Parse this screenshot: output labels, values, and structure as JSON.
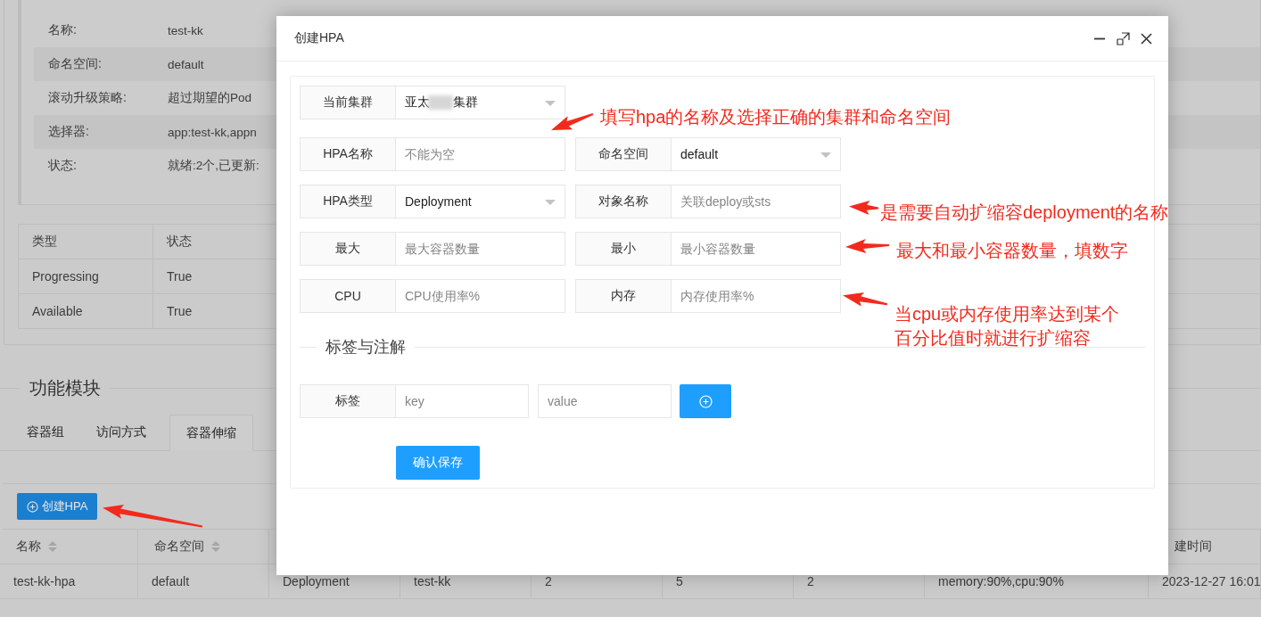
{
  "details": [
    {
      "label": "名称:",
      "value": "test-kk"
    },
    {
      "label": "命名空间:",
      "value": "default"
    },
    {
      "label": "滚动升级策略:",
      "value": "超过期望的Pod"
    },
    {
      "label": "选择器:",
      "value": "app:test-kk,appn"
    },
    {
      "label": "状态:",
      "value": "就绪:2个,已更新:"
    }
  ],
  "conditions": {
    "columns": [
      "类型",
      "状态"
    ],
    "rows": [
      [
        "Progressing",
        "True"
      ],
      [
        "Available",
        "True"
      ]
    ]
  },
  "section_title": "功能模块",
  "tabs": [
    {
      "label": "容器组",
      "selected": false
    },
    {
      "label": "访问方式",
      "selected": false
    },
    {
      "label": "容器伸缩",
      "selected": true
    }
  ],
  "create_button": "创建HPA",
  "hpa_table": {
    "header_left": [
      "名称",
      "命名空间"
    ],
    "header_right": "建时间",
    "rows": [
      [
        "test-kk-hpa",
        "default",
        "Deployment",
        "test-kk",
        "2",
        "5",
        "2",
        "memory:90%,cpu:90%",
        "2023-12-27 16:01"
      ]
    ]
  },
  "dialog": {
    "title": "创建HPA",
    "cluster": {
      "label": "当前集群",
      "value_start": "亚太",
      "value_end": "集群",
      "redacted": true
    },
    "rows": [
      [
        {
          "label": "HPA名称",
          "kind": "input",
          "placeholder": "不能为空"
        },
        {
          "label": "命名空间",
          "kind": "select",
          "value": "default"
        }
      ],
      [
        {
          "label": "HPA类型",
          "kind": "select",
          "value": "Deployment"
        },
        {
          "label": "对象名称",
          "kind": "input",
          "placeholder": "关联deploy或sts"
        }
      ],
      [
        {
          "label": "最大",
          "kind": "input",
          "placeholder": "最大容器数量"
        },
        {
          "label": "最小",
          "kind": "input",
          "placeholder": "最小容器数量"
        }
      ],
      [
        {
          "label": "CPU",
          "kind": "input",
          "placeholder": "CPU使用率%"
        },
        {
          "label": "内存",
          "kind": "input",
          "placeholder": "内存使用率%"
        }
      ]
    ],
    "labels_section": "标签与注解",
    "tag": {
      "label": "标签",
      "key_placeholder": "key",
      "value_placeholder": "value"
    },
    "save_button": "确认保存"
  },
  "annotations": [
    {
      "lines": [
        "填写hpa的名称及选择正确的集群和命名空间"
      ]
    },
    {
      "lines": [
        "是需要自动扩缩容deployment的名称"
      ]
    },
    {
      "lines": [
        "最大和最小容器数量，填数字"
      ]
    },
    {
      "lines": [
        "当cpu或内存使用率达到某个",
        "百分比值时就进行扩缩容"
      ]
    }
  ]
}
